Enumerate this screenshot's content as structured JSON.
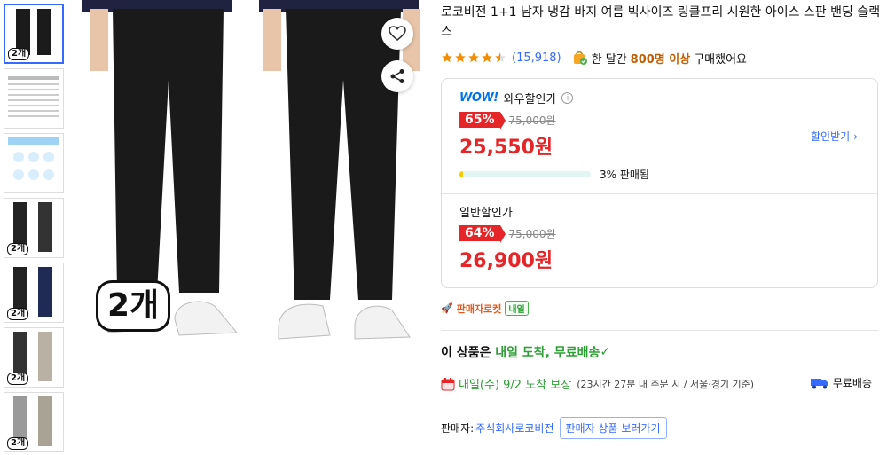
{
  "thumbnails": [
    {
      "tag": "2개",
      "active": true
    },
    {
      "tag": "",
      "active": false
    },
    {
      "tag": "",
      "active": false
    },
    {
      "tag": "2개",
      "active": false
    },
    {
      "tag": "2개",
      "active": false
    },
    {
      "tag": "2개",
      "active": false
    },
    {
      "tag": "2개",
      "active": false
    }
  ],
  "main_image": {
    "badge": "2개"
  },
  "product": {
    "title": "로코비전 1+1 남자 냉감 바지 여름 빅사이즈 링클프리 시원한 아이스 스판 밴딩 슬랙스",
    "rating": 4.5,
    "review_count": "(15,918)",
    "bought_prefix": "한 달간",
    "bought_count": "800명 이상",
    "bought_suffix": "구매했어요"
  },
  "wow_price": {
    "logo": "WOW!",
    "label": "와우할인가",
    "info_icon": "ⓘ",
    "discount": "65%",
    "original": "75,000원",
    "final": "25,550원",
    "coupon_label": "할인받기",
    "sold_percent": 3,
    "sold_text": "3% 판매됨"
  },
  "general_price": {
    "label": "일반할인가",
    "discount": "64%",
    "original": "75,000원",
    "final": "26,900원"
  },
  "rocket": {
    "label": "판매자로켓",
    "badge": "내일"
  },
  "delivery": {
    "head_prefix": "이 상품은",
    "head_green": "내일 도착, 무료배송",
    "eta_main": "내일(수) 9/2 도착 보장",
    "eta_sub": "(23시간 27분 내 주문 시 / 서울·경기 기준)",
    "free_ship": "무료배송"
  },
  "seller": {
    "label": "판매자:",
    "name": "주식회사로코비전",
    "button": "판매자 상품 보러가기"
  },
  "colors": {
    "accent_red": "#e52528",
    "accent_blue": "#346aff",
    "green": "#2e9e37",
    "star": "#f48c00"
  }
}
